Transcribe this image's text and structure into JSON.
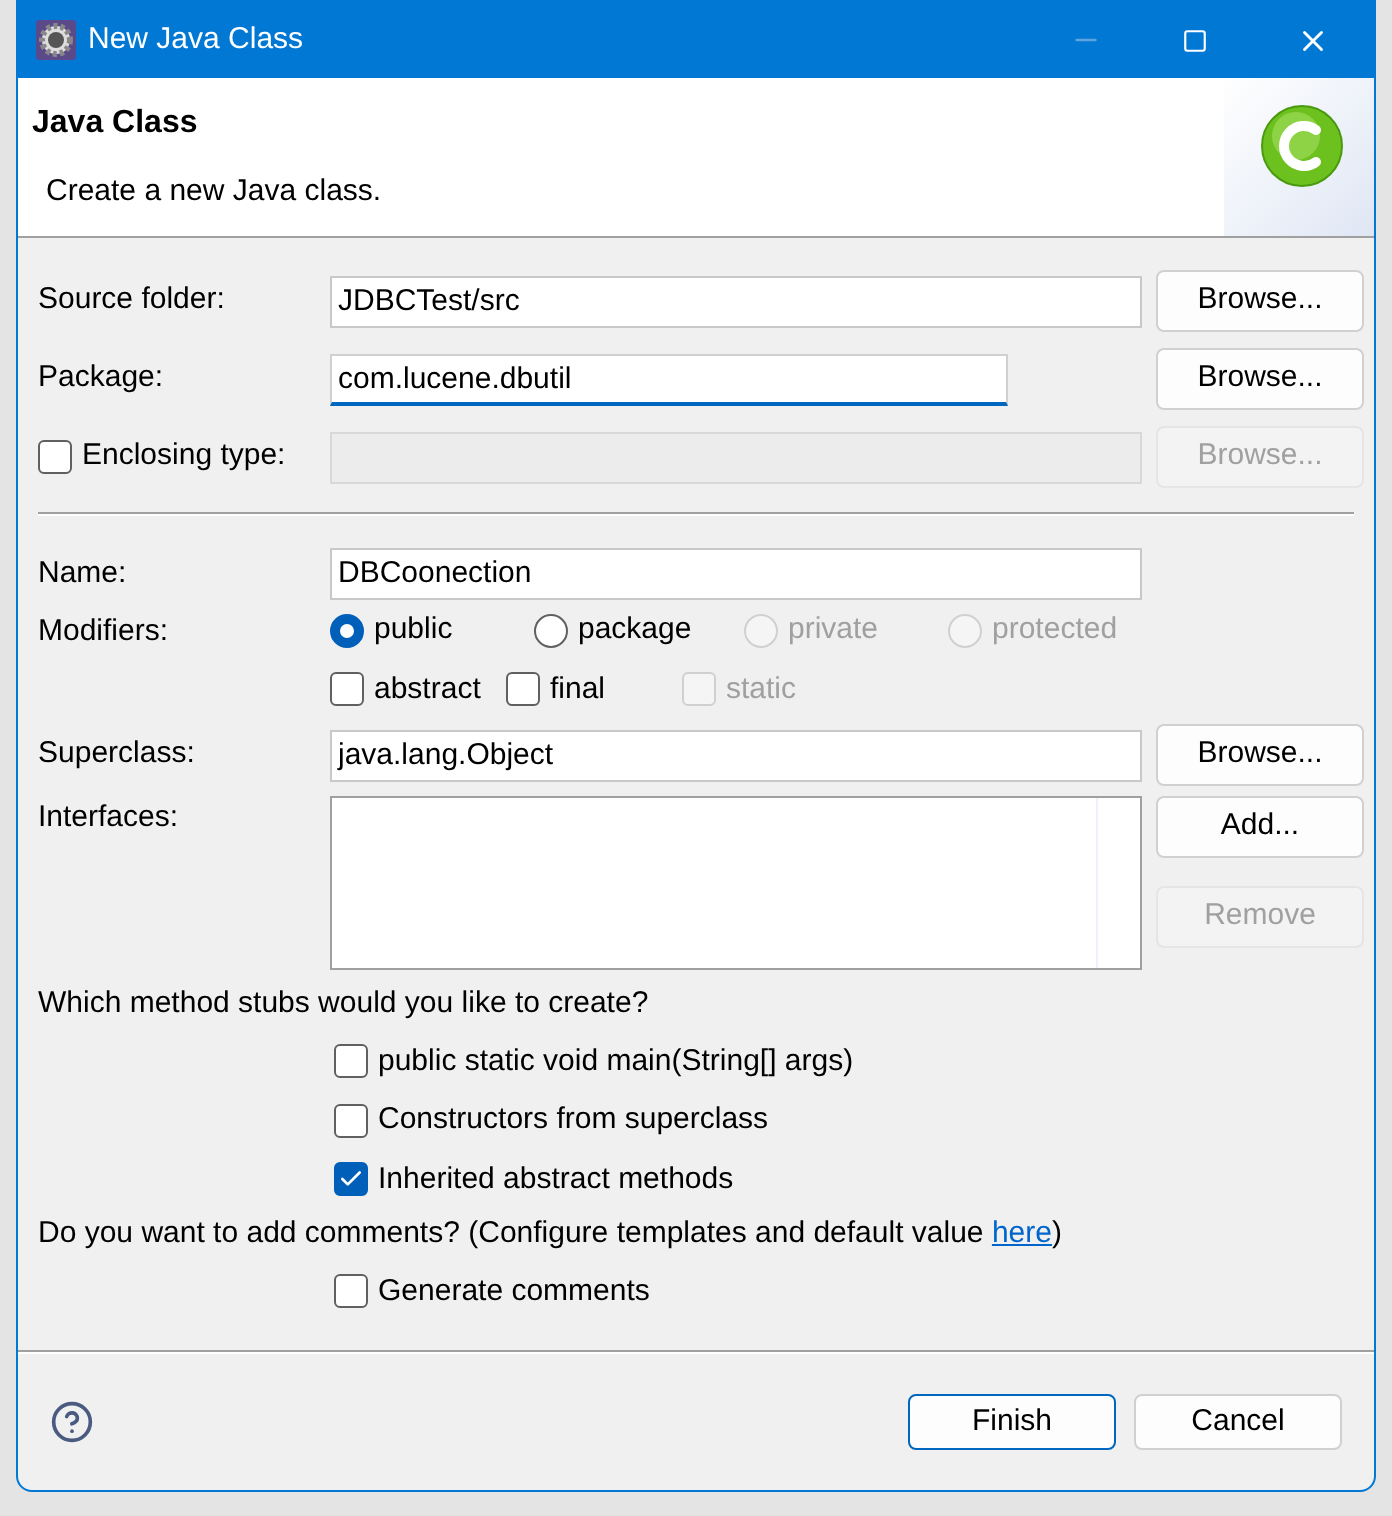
{
  "window": {
    "title": "New Java Class"
  },
  "header": {
    "title": "Java Class",
    "description": "Create a new Java class."
  },
  "source_folder": {
    "label": "Source folder:",
    "value": "JDBCTest/src",
    "button": {
      "label": "Browse...",
      "disabled": false
    }
  },
  "package": {
    "label": "Package:",
    "value": "com.lucene.dbutil",
    "focused": true,
    "button": {
      "label": "Browse...",
      "disabled": false
    }
  },
  "enclosing_type": {
    "label": "Enclosing type:",
    "checked": false,
    "disabled": true,
    "button": {
      "label": "Browse...",
      "disabled": true
    }
  },
  "name": {
    "label": "Name:",
    "value": "DBCoonection"
  },
  "modifiers": {
    "label": "Modifiers:",
    "access": [
      {
        "label": "public",
        "selected": true,
        "disabled": false
      },
      {
        "label": "package",
        "selected": false,
        "disabled": false
      },
      {
        "label": "private",
        "selected": false,
        "disabled": true
      },
      {
        "label": "protected",
        "selected": false,
        "disabled": true
      }
    ],
    "flags": [
      {
        "label": "abstract",
        "checked": false,
        "disabled": false
      },
      {
        "label": "final",
        "checked": false,
        "disabled": false
      },
      {
        "label": "static",
        "checked": false,
        "disabled": true
      }
    ]
  },
  "superclass": {
    "label": "Superclass:",
    "value": "java.lang.Object",
    "button": {
      "label": "Browse...",
      "disabled": false
    }
  },
  "interfaces": {
    "label": "Interfaces:",
    "buttons": [
      {
        "label": "Add...",
        "disabled": false
      },
      {
        "label": "Remove",
        "disabled": true
      }
    ]
  },
  "method_stubs": {
    "question": "Which method stubs would you like to create?",
    "options": [
      {
        "label": "public static void main(String[] args)",
        "checked": false
      },
      {
        "label": "Constructors from superclass",
        "checked": false
      },
      {
        "label": "Inherited abstract methods",
        "checked": true
      }
    ]
  },
  "comments": {
    "question": "Do you want to add comments? (Configure templates and default value ",
    "link": "here",
    "closing": ")",
    "option": {
      "label": "Generate comments",
      "checked": false
    }
  },
  "footer": {
    "buttons": [
      {
        "label": "Finish",
        "default": true
      },
      {
        "label": "Cancel",
        "default": false
      }
    ]
  }
}
